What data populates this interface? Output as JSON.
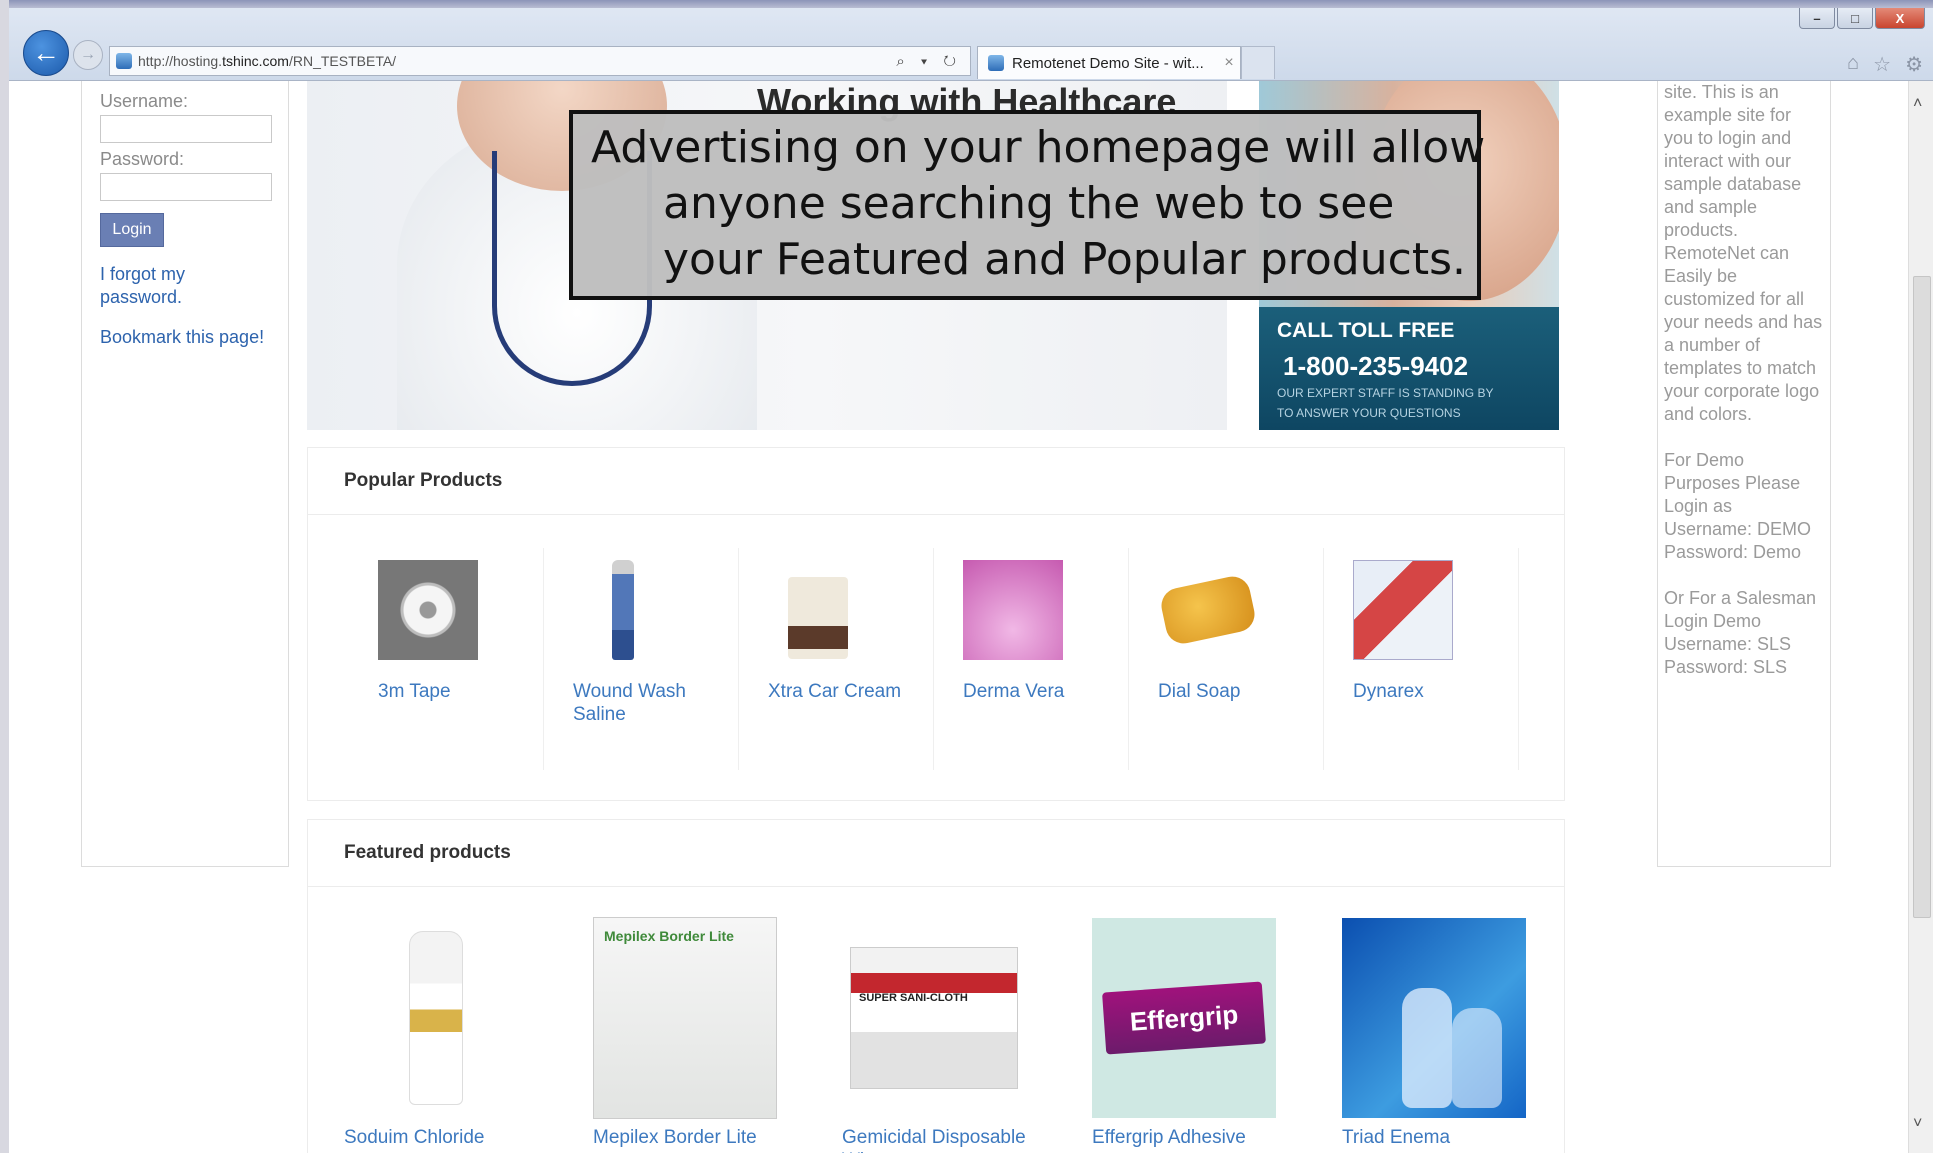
{
  "browser": {
    "url_prefix": "http://hosting.",
    "url_domain": "tshinc.com",
    "url_path": "/RN_TESTBETA/",
    "tab_title": "Remotenet Demo Site - wit...",
    "tab_close": "×",
    "win_minimize": "–",
    "win_restore": "□",
    "win_close": "X",
    "address_tools": "⌕ ▾ ↻",
    "icons": [
      "back-icon",
      "forward-icon",
      "search-icon",
      "refresh-icon",
      "home-icon",
      "star-icon",
      "gear-icon"
    ]
  },
  "login": {
    "username_label": "Username:",
    "username_value": "",
    "password_label": "Password:",
    "password_value": "",
    "login_button": "Login",
    "forgot_link": "I forgot my password.",
    "bookmark_link": "Bookmark this page!"
  },
  "hero": {
    "heading": "Working with Healthcare",
    "promo_call": "CALL TOLL FREE",
    "promo_phone": "1-800-235-9402",
    "promo_sub1": "OUR EXPERT STAFF IS STANDING BY",
    "promo_sub2": "TO ANSWER YOUR QUESTIONS"
  },
  "callout": {
    "line1": "Advertising on your homepage will allow",
    "line2": "anyone searching the web to see",
    "line3": "your Featured and Popular products."
  },
  "popular": {
    "title": "Popular Products",
    "items": [
      {
        "name": "3m Tape"
      },
      {
        "name": "Wound Wash Saline"
      },
      {
        "name": "Xtra Car Cream"
      },
      {
        "name": "Derma Vera"
      },
      {
        "name": "Dial Soap"
      },
      {
        "name": "Dynarex"
      }
    ]
  },
  "featured": {
    "title": "Featured products",
    "items": [
      {
        "name": "Soduim Chloride"
      },
      {
        "name": "Mepilex Border Lite"
      },
      {
        "name": "Gemicidal Disposable Wipes"
      },
      {
        "name": "Effergrip Adhesive"
      },
      {
        "name": "Triad Enema"
      }
    ],
    "mepilex_label": "Mepilex Border Lite",
    "wipe_label": "SUPER SANI-CLOTH",
    "effergrip_label": "Effergrip"
  },
  "sidebar_right": {
    "p1": "site. This is an example site for you to login and interact with our sample database and sample products. RemoteNet can Easily be customized for all your needs and has a number of templates to match your corporate logo and colors.",
    "p2": "For Demo Purposes Please Login as\nUsername: DEMO\nPassword: Demo",
    "p3": "Or For a Salesman Login Demo\nUsername: SLS\nPassword: SLS"
  },
  "scroll": {
    "up": "˄",
    "down": "˅"
  }
}
